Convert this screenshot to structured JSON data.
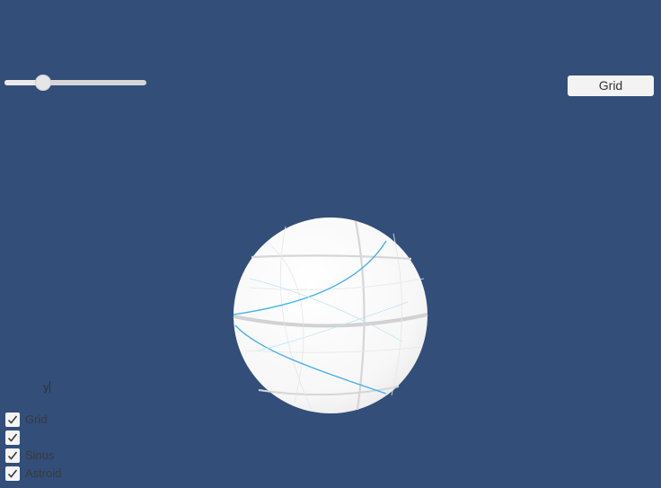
{
  "theme": {
    "background": "#324e79",
    "accent_curve": "#3fb0e8"
  },
  "slider": {
    "value_fraction": 0.24
  },
  "grid_button": {
    "label": "Grid"
  },
  "text_field": {
    "value": "y"
  },
  "toggles": [
    {
      "label": "Grid",
      "checked": true
    },
    {
      "label": "",
      "checked": true
    },
    {
      "label": "Sinus",
      "checked": true
    },
    {
      "label": "Astroid",
      "checked": true
    }
  ]
}
